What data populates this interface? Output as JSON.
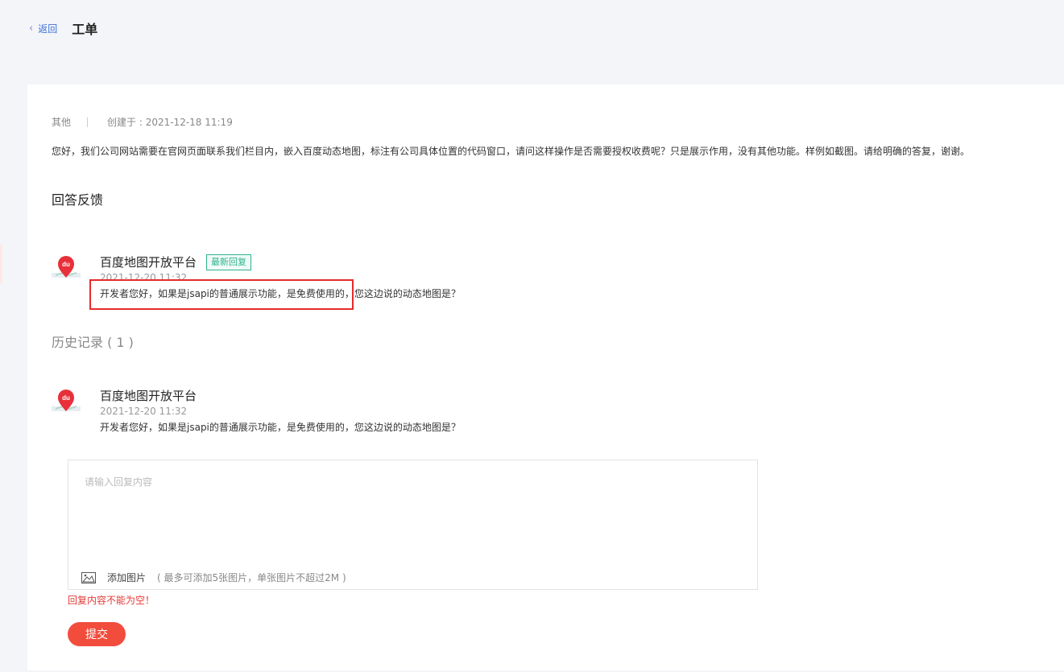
{
  "header": {
    "back_label": "返回",
    "title": "工单"
  },
  "ticket": {
    "category": "其他",
    "created_at": "创建于 : 2021-12-18 11:19",
    "description": "您好，我们公司网站需要在官网页面联系我们栏目内，嵌入百度动态地图，标注有公司具体位置的代码窗口，请问这样操作是否需要授权收费呢？只是展示作用，没有其他功能。样例如截图。请给明确的答复，谢谢。"
  },
  "feedback": {
    "section_title": "回答反馈",
    "latest": {
      "author": "百度地图开放平台",
      "badge": "最新回复",
      "time": "2021-12-20 11:32",
      "text": "开发者您好，如果是jsapi的普通展示功能，是免费使用的，您这边说的动态地图是？"
    }
  },
  "history": {
    "title": "历史记录 ( 1 )",
    "items": [
      {
        "author": "百度地图开放平台",
        "time": "2021-12-20 11:32",
        "text": "开发者您好，如果是jsapi的普通展示功能，是免费使用的，您这边说的动态地图是？"
      }
    ]
  },
  "reply_form": {
    "placeholder": "请输入回复内容",
    "add_image_label": "添加图片",
    "add_image_hint": "( 最多可添加5张图片，单张图片不超过2M )",
    "error": "回复内容不能为空！",
    "submit_label": "提交"
  },
  "avatar_text": "du",
  "colors": {
    "accent_red": "#f24c3d",
    "badge_green": "#2fb38e",
    "link_blue": "#3a6fd8"
  }
}
